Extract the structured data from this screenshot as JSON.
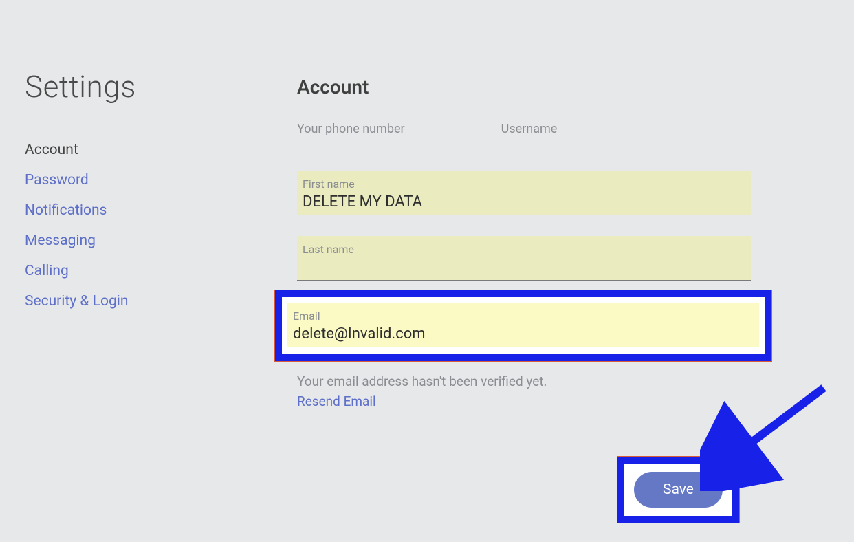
{
  "sidebar": {
    "title": "Settings",
    "items": [
      {
        "label": "Account",
        "active": true
      },
      {
        "label": "Password",
        "active": false
      },
      {
        "label": "Notifications",
        "active": false
      },
      {
        "label": "Messaging",
        "active": false
      },
      {
        "label": "Calling",
        "active": false
      },
      {
        "label": "Security & Login",
        "active": false
      }
    ]
  },
  "main": {
    "title": "Account",
    "phone_label": "Your phone number",
    "username_label": "Username",
    "first_name": {
      "label": "First name",
      "value": "DELETE MY DATA"
    },
    "last_name": {
      "label": "Last name",
      "value": ""
    },
    "email": {
      "label": "Email",
      "value": "delete@Invalid.com"
    },
    "verify_text": "Your email address hasn't been verified yet.",
    "resend_label": "Resend Email",
    "save_label": "Save"
  },
  "colors": {
    "highlight_border": "#1721e8",
    "link": "#5d6fc8",
    "autofill_bg": "#ebebc0",
    "autofill_light": "#fbfac5",
    "button": "#6478c6"
  }
}
